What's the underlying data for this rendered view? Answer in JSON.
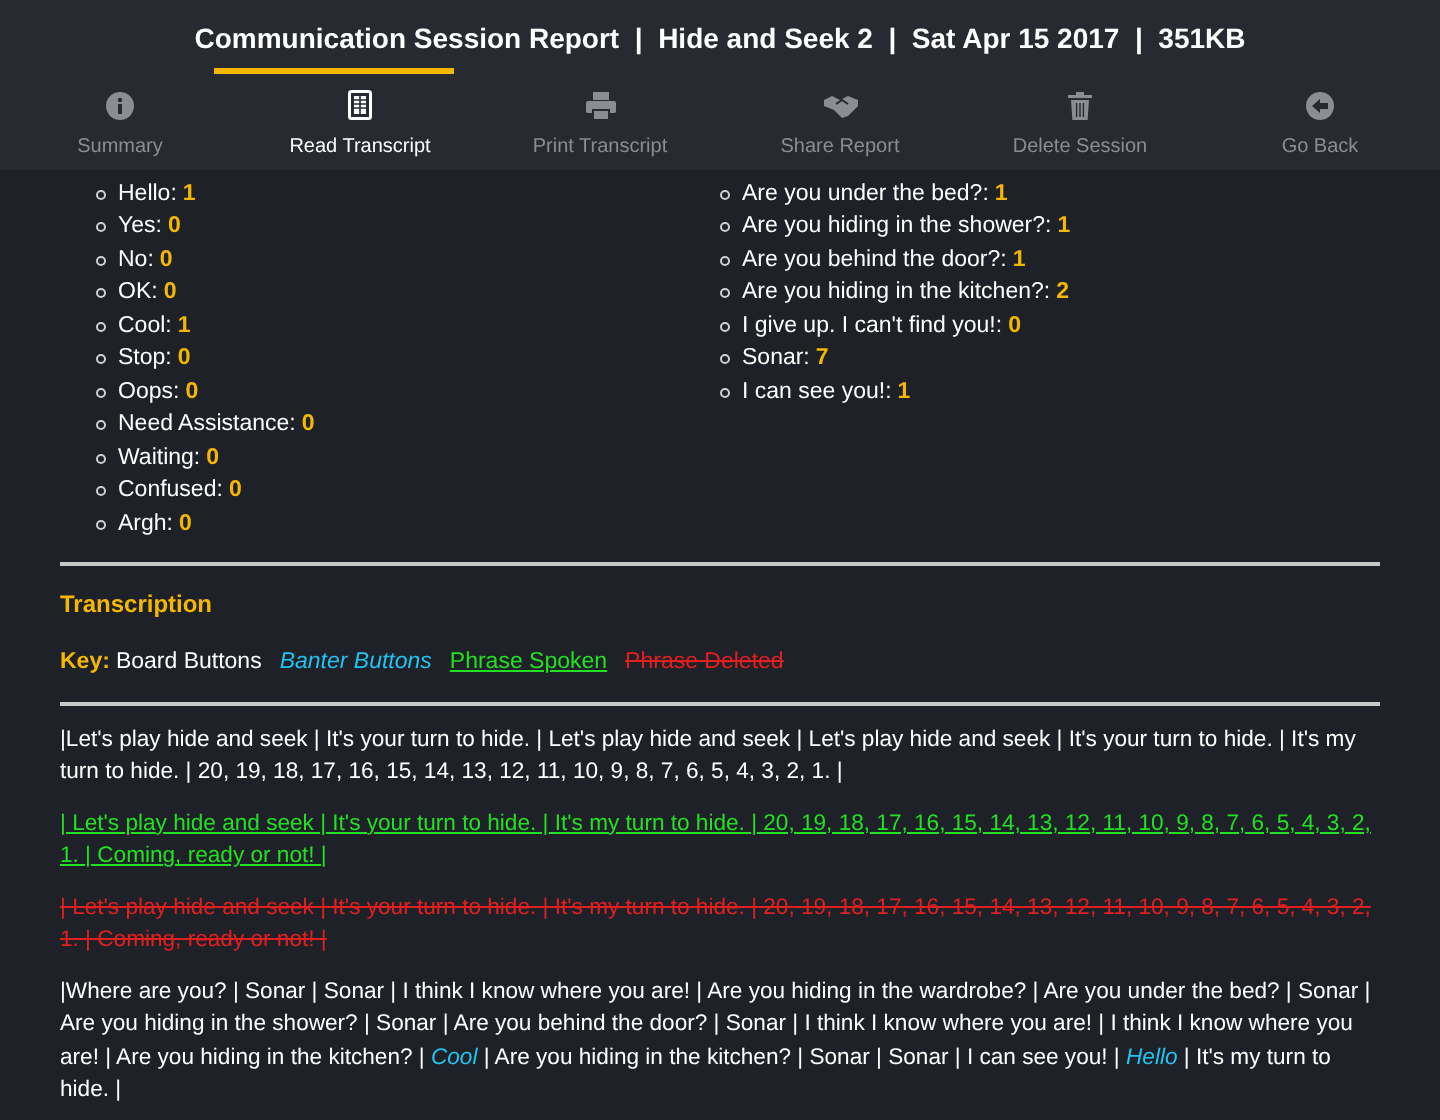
{
  "header": {
    "title": "Communication Session Report  |  Hide and Seek 2  |  Sat Apr 15 2017  |  351KB"
  },
  "tabs": [
    {
      "label": "Summary",
      "kind": "info",
      "selected": false
    },
    {
      "label": "Read Transcript",
      "kind": "document",
      "selected": true
    },
    {
      "label": "Print Transcript",
      "kind": "printer",
      "selected": false
    },
    {
      "label": "Share Report",
      "kind": "handshake",
      "selected": false
    },
    {
      "label": "Delete Session",
      "kind": "trash",
      "selected": false
    },
    {
      "label": "Go Back",
      "kind": "back",
      "selected": false
    }
  ],
  "counts_left": [
    {
      "label": "Hello:",
      "count": "1"
    },
    {
      "label": "Yes:",
      "count": "0"
    },
    {
      "label": "No:",
      "count": "0"
    },
    {
      "label": "OK:",
      "count": "0"
    },
    {
      "label": "Cool:",
      "count": "1"
    },
    {
      "label": "Stop:",
      "count": "0"
    },
    {
      "label": "Oops:",
      "count": "0"
    },
    {
      "label": "Need Assistance:",
      "count": "0"
    },
    {
      "label": "Waiting:",
      "count": "0"
    },
    {
      "label": "Confused:",
      "count": "0"
    },
    {
      "label": "Argh:",
      "count": "0"
    }
  ],
  "counts_right": [
    {
      "label": "Are you under the bed?:",
      "count": "1"
    },
    {
      "label": "Are you hiding in the shower?:",
      "count": "1"
    },
    {
      "label": "Are you behind the door?:",
      "count": "1"
    },
    {
      "label": "Are you hiding in the kitchen?:",
      "count": "2"
    },
    {
      "label": "I give up. I can't find you!:",
      "count": "0"
    },
    {
      "label": "Sonar:",
      "count": "7"
    },
    {
      "label": "I can see you!:",
      "count": "1"
    }
  ],
  "transcription": {
    "heading": "Transcription",
    "key_label": "Key:",
    "key": [
      {
        "text": "Board Buttons",
        "kind": "board"
      },
      {
        "text": "Banter Buttons",
        "kind": "banter"
      },
      {
        "text": "Phrase Spoken",
        "kind": "spoken"
      },
      {
        "text": "Phrase Deleted",
        "kind": "deleted"
      }
    ],
    "paragraphs": [
      [
        {
          "text": "|Let's play hide and seek | It's your turn to hide. | Let's play hide and seek | Let's play hide and seek | It's your turn to hide. | It's my turn to hide. | 20, 19, 18, 17, 16, 15, 14, 13, 12, 11, 10, 9, 8, 7, 6, 5, 4, 3, 2, 1. |",
          "kind": "board"
        }
      ],
      [
        {
          "text": "| Let's play hide and seek | It's your turn to hide. | It's my turn to hide. | 20, 19, 18, 17, 16, 15, 14, 13, 12, 11, 10, 9, 8, 7, 6, 5, 4, 3, 2, 1. | Coming, ready or not! |",
          "kind": "spoken"
        }
      ],
      [
        {
          "text": "| Let's play hide and seek | It's your turn to hide. | It's my turn to hide. | 20, 19, 18, 17, 16, 15, 14, 13, 12, 11, 10, 9, 8, 7, 6, 5, 4, 3, 2, 1. | Coming, ready or not! |",
          "kind": "deleted"
        }
      ],
      [
        {
          "text": "|Where are you? | Sonar | Sonar | I think I know where you are! | Are you hiding in the wardrobe? | Are you under the bed? | Sonar | Are you hiding in the shower? | Sonar | Are you behind the door? | Sonar | I think I know where you are! | I think I know where you are! | Are you hiding in the kitchen? |",
          "kind": "board"
        },
        {
          "text": "Cool",
          "kind": "banter"
        },
        {
          "text": "| Are you hiding in the kitchen? | Sonar | Sonar | I can see you! |",
          "kind": "board"
        },
        {
          "text": "Hello",
          "kind": "banter"
        },
        {
          "text": "| It's my turn to hide. |",
          "kind": "board"
        }
      ]
    ]
  }
}
